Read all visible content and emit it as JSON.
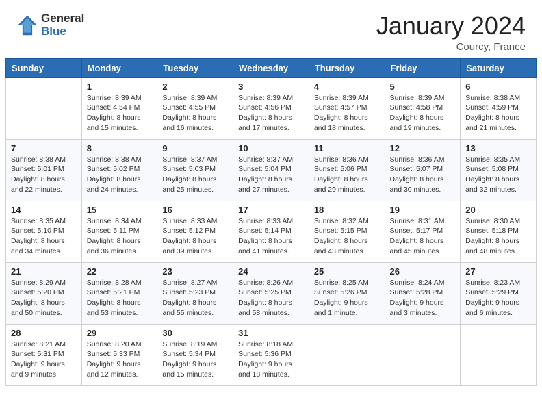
{
  "header": {
    "logo_general": "General",
    "logo_blue": "Blue",
    "title": "January 2024",
    "location": "Courcy, France"
  },
  "columns": [
    "Sunday",
    "Monday",
    "Tuesday",
    "Wednesday",
    "Thursday",
    "Friday",
    "Saturday"
  ],
  "weeks": [
    [
      {
        "day": "",
        "sunrise": "",
        "sunset": "",
        "daylight": ""
      },
      {
        "day": "1",
        "sunrise": "Sunrise: 8:39 AM",
        "sunset": "Sunset: 4:54 PM",
        "daylight": "Daylight: 8 hours and 15 minutes."
      },
      {
        "day": "2",
        "sunrise": "Sunrise: 8:39 AM",
        "sunset": "Sunset: 4:55 PM",
        "daylight": "Daylight: 8 hours and 16 minutes."
      },
      {
        "day": "3",
        "sunrise": "Sunrise: 8:39 AM",
        "sunset": "Sunset: 4:56 PM",
        "daylight": "Daylight: 8 hours and 17 minutes."
      },
      {
        "day": "4",
        "sunrise": "Sunrise: 8:39 AM",
        "sunset": "Sunset: 4:57 PM",
        "daylight": "Daylight: 8 hours and 18 minutes."
      },
      {
        "day": "5",
        "sunrise": "Sunrise: 8:39 AM",
        "sunset": "Sunset: 4:58 PM",
        "daylight": "Daylight: 8 hours and 19 minutes."
      },
      {
        "day": "6",
        "sunrise": "Sunrise: 8:38 AM",
        "sunset": "Sunset: 4:59 PM",
        "daylight": "Daylight: 8 hours and 21 minutes."
      }
    ],
    [
      {
        "day": "7",
        "sunrise": "Sunrise: 8:38 AM",
        "sunset": "Sunset: 5:01 PM",
        "daylight": "Daylight: 8 hours and 22 minutes."
      },
      {
        "day": "8",
        "sunrise": "Sunrise: 8:38 AM",
        "sunset": "Sunset: 5:02 PM",
        "daylight": "Daylight: 8 hours and 24 minutes."
      },
      {
        "day": "9",
        "sunrise": "Sunrise: 8:37 AM",
        "sunset": "Sunset: 5:03 PM",
        "daylight": "Daylight: 8 hours and 25 minutes."
      },
      {
        "day": "10",
        "sunrise": "Sunrise: 8:37 AM",
        "sunset": "Sunset: 5:04 PM",
        "daylight": "Daylight: 8 hours and 27 minutes."
      },
      {
        "day": "11",
        "sunrise": "Sunrise: 8:36 AM",
        "sunset": "Sunset: 5:06 PM",
        "daylight": "Daylight: 8 hours and 29 minutes."
      },
      {
        "day": "12",
        "sunrise": "Sunrise: 8:36 AM",
        "sunset": "Sunset: 5:07 PM",
        "daylight": "Daylight: 8 hours and 30 minutes."
      },
      {
        "day": "13",
        "sunrise": "Sunrise: 8:35 AM",
        "sunset": "Sunset: 5:08 PM",
        "daylight": "Daylight: 8 hours and 32 minutes."
      }
    ],
    [
      {
        "day": "14",
        "sunrise": "Sunrise: 8:35 AM",
        "sunset": "Sunset: 5:10 PM",
        "daylight": "Daylight: 8 hours and 34 minutes."
      },
      {
        "day": "15",
        "sunrise": "Sunrise: 8:34 AM",
        "sunset": "Sunset: 5:11 PM",
        "daylight": "Daylight: 8 hours and 36 minutes."
      },
      {
        "day": "16",
        "sunrise": "Sunrise: 8:33 AM",
        "sunset": "Sunset: 5:12 PM",
        "daylight": "Daylight: 8 hours and 39 minutes."
      },
      {
        "day": "17",
        "sunrise": "Sunrise: 8:33 AM",
        "sunset": "Sunset: 5:14 PM",
        "daylight": "Daylight: 8 hours and 41 minutes."
      },
      {
        "day": "18",
        "sunrise": "Sunrise: 8:32 AM",
        "sunset": "Sunset: 5:15 PM",
        "daylight": "Daylight: 8 hours and 43 minutes."
      },
      {
        "day": "19",
        "sunrise": "Sunrise: 8:31 AM",
        "sunset": "Sunset: 5:17 PM",
        "daylight": "Daylight: 8 hours and 45 minutes."
      },
      {
        "day": "20",
        "sunrise": "Sunrise: 8:30 AM",
        "sunset": "Sunset: 5:18 PM",
        "daylight": "Daylight: 8 hours and 48 minutes."
      }
    ],
    [
      {
        "day": "21",
        "sunrise": "Sunrise: 8:29 AM",
        "sunset": "Sunset: 5:20 PM",
        "daylight": "Daylight: 8 hours and 50 minutes."
      },
      {
        "day": "22",
        "sunrise": "Sunrise: 8:28 AM",
        "sunset": "Sunset: 5:21 PM",
        "daylight": "Daylight: 8 hours and 53 minutes."
      },
      {
        "day": "23",
        "sunrise": "Sunrise: 8:27 AM",
        "sunset": "Sunset: 5:23 PM",
        "daylight": "Daylight: 8 hours and 55 minutes."
      },
      {
        "day": "24",
        "sunrise": "Sunrise: 8:26 AM",
        "sunset": "Sunset: 5:25 PM",
        "daylight": "Daylight: 8 hours and 58 minutes."
      },
      {
        "day": "25",
        "sunrise": "Sunrise: 8:25 AM",
        "sunset": "Sunset: 5:26 PM",
        "daylight": "Daylight: 9 hours and 1 minute."
      },
      {
        "day": "26",
        "sunrise": "Sunrise: 8:24 AM",
        "sunset": "Sunset: 5:28 PM",
        "daylight": "Daylight: 9 hours and 3 minutes."
      },
      {
        "day": "27",
        "sunrise": "Sunrise: 8:23 AM",
        "sunset": "Sunset: 5:29 PM",
        "daylight": "Daylight: 9 hours and 6 minutes."
      }
    ],
    [
      {
        "day": "28",
        "sunrise": "Sunrise: 8:21 AM",
        "sunset": "Sunset: 5:31 PM",
        "daylight": "Daylight: 9 hours and 9 minutes."
      },
      {
        "day": "29",
        "sunrise": "Sunrise: 8:20 AM",
        "sunset": "Sunset: 5:33 PM",
        "daylight": "Daylight: 9 hours and 12 minutes."
      },
      {
        "day": "30",
        "sunrise": "Sunrise: 8:19 AM",
        "sunset": "Sunset: 5:34 PM",
        "daylight": "Daylight: 9 hours and 15 minutes."
      },
      {
        "day": "31",
        "sunrise": "Sunrise: 8:18 AM",
        "sunset": "Sunset: 5:36 PM",
        "daylight": "Daylight: 9 hours and 18 minutes."
      },
      {
        "day": "",
        "sunrise": "",
        "sunset": "",
        "daylight": ""
      },
      {
        "day": "",
        "sunrise": "",
        "sunset": "",
        "daylight": ""
      },
      {
        "day": "",
        "sunrise": "",
        "sunset": "",
        "daylight": ""
      }
    ]
  ]
}
